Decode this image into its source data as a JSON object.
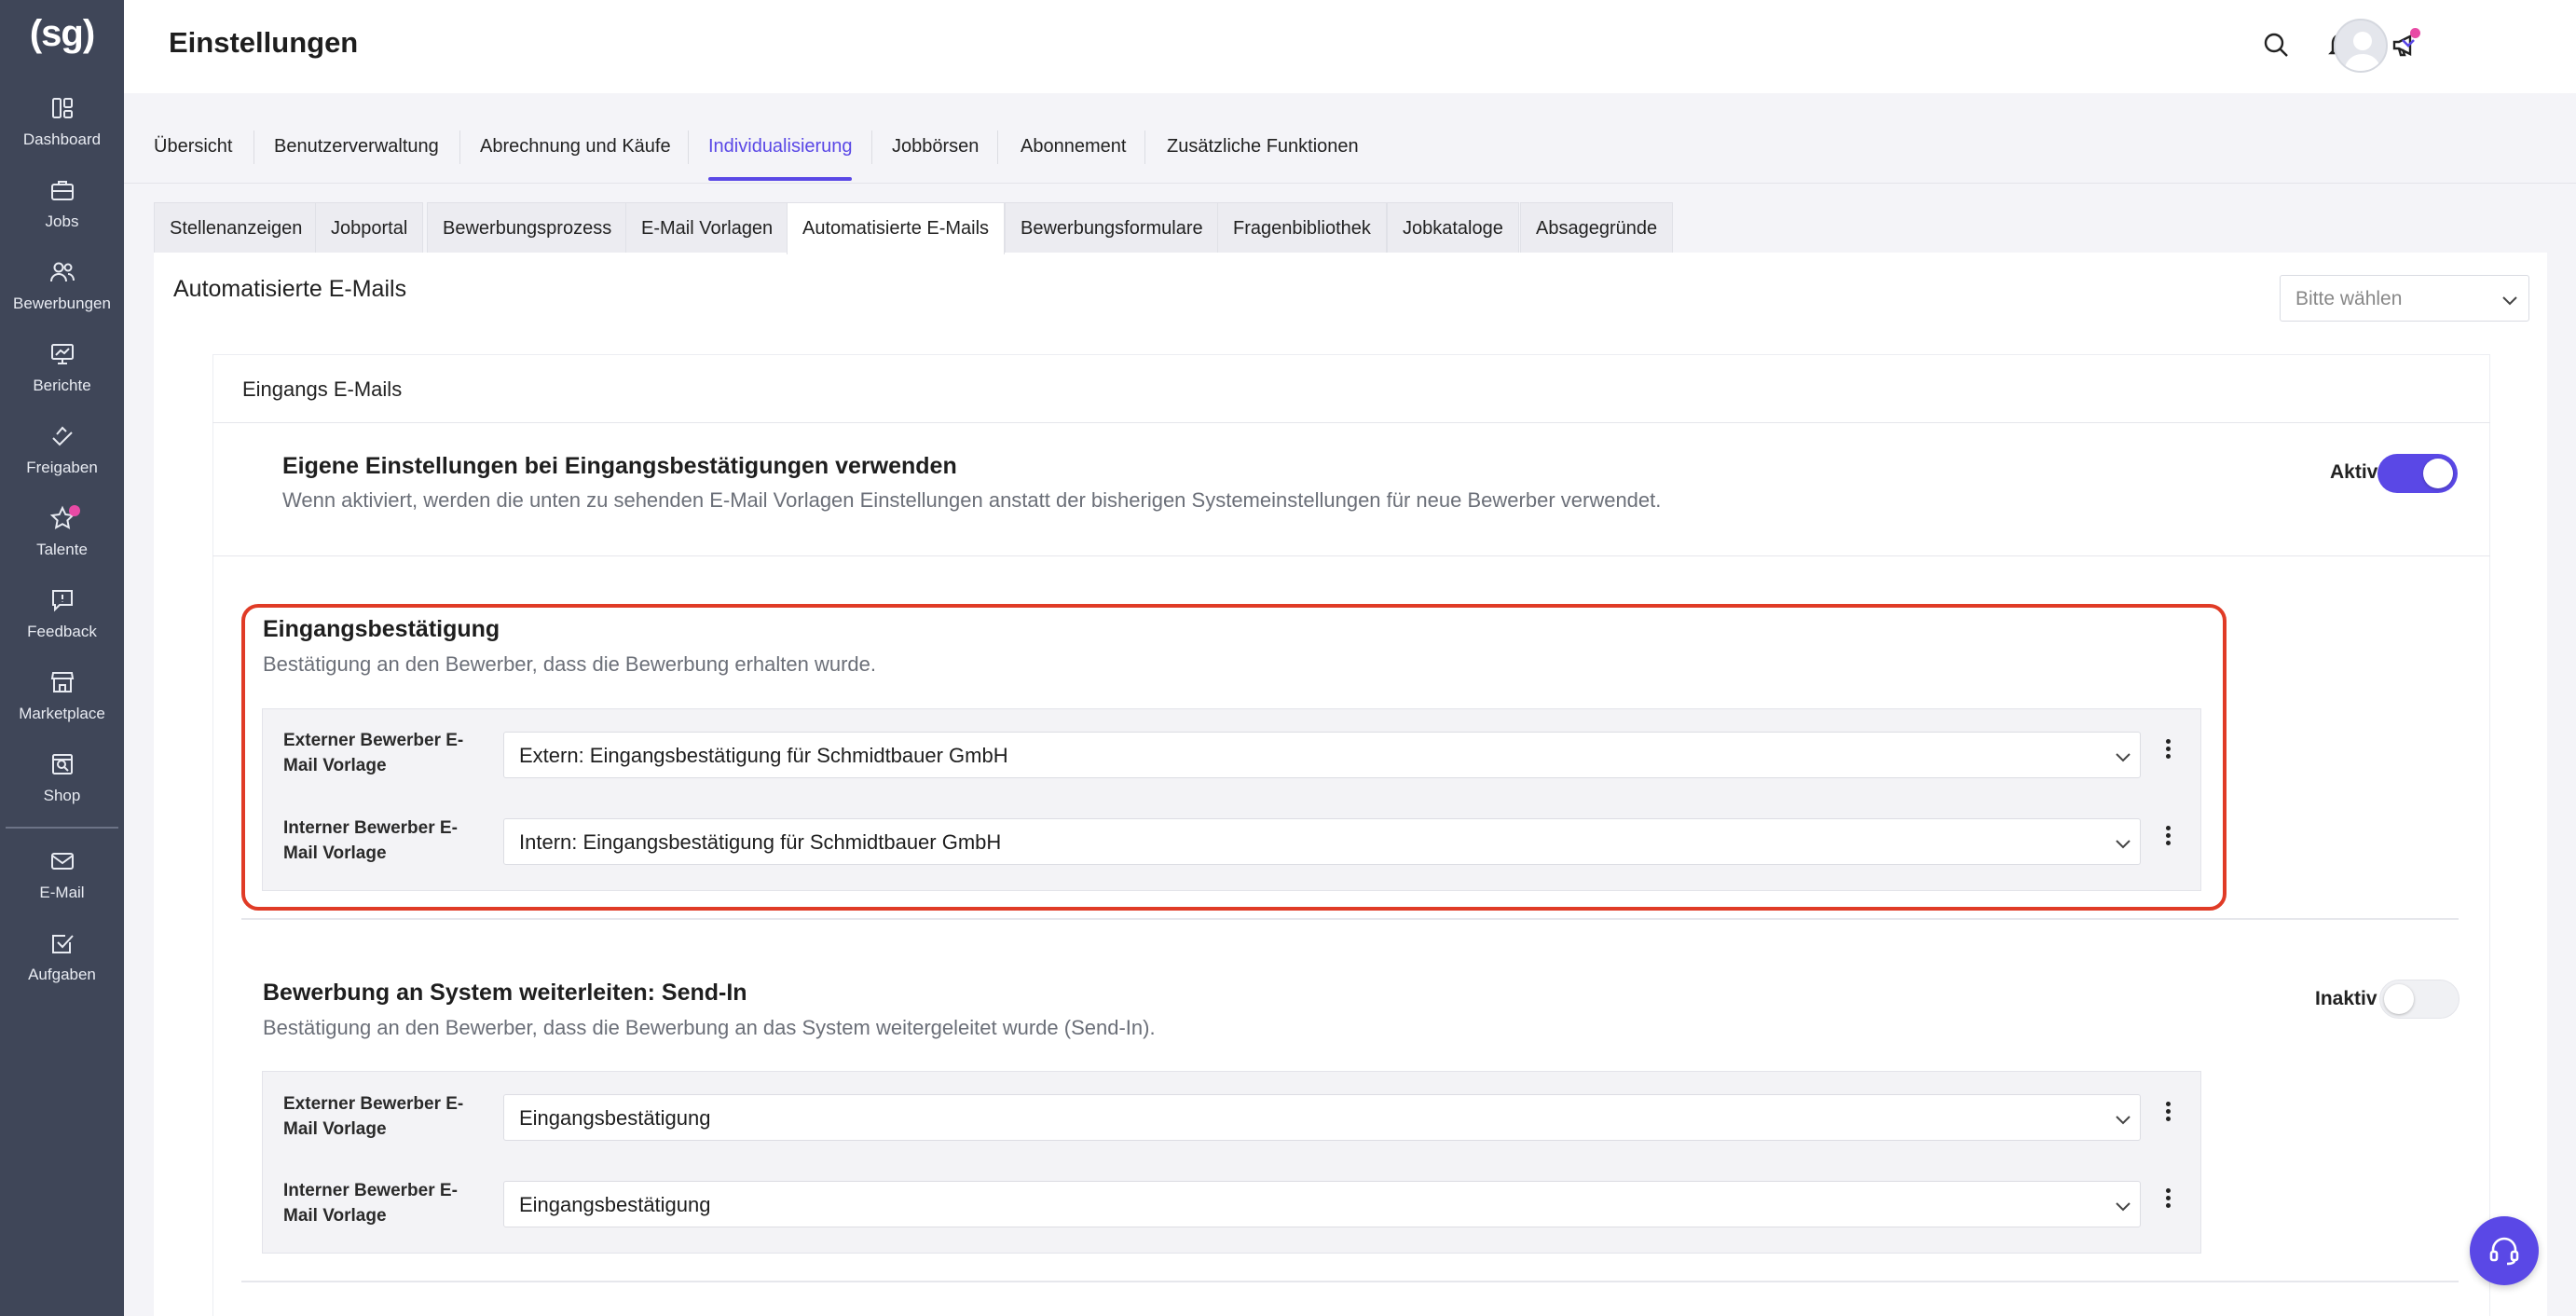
{
  "app": {
    "logo": "(sg)"
  },
  "sidebar": {
    "items": [
      {
        "label": "Dashboard",
        "icon": "dashboard-icon"
      },
      {
        "label": "Jobs",
        "icon": "briefcase-icon"
      },
      {
        "label": "Bewerbungen",
        "icon": "users-icon"
      },
      {
        "label": "Berichte",
        "icon": "chart-board-icon"
      },
      {
        "label": "Freigaben",
        "icon": "hand-approve-icon"
      },
      {
        "label": "Talente",
        "icon": "star-icon",
        "badge": true
      },
      {
        "label": "Feedback",
        "icon": "feedback-icon"
      },
      {
        "label": "Marketplace",
        "icon": "store-icon"
      },
      {
        "label": "Shop",
        "icon": "shop-search-icon"
      },
      {
        "label": "E-Mail",
        "icon": "mail-icon"
      },
      {
        "label": "Aufgaben",
        "icon": "checkbox-icon"
      }
    ]
  },
  "header": {
    "title": "Einstellungen",
    "icons": [
      "search-icon",
      "bell-icon",
      "megaphone-icon"
    ],
    "accent_color": "#5a48e6",
    "badge_color": "#e84aa5"
  },
  "tabs": [
    "Übersicht",
    "Benutzerverwaltung",
    "Abrechnung und Käufe",
    "Individualisierung",
    "Jobbörsen",
    "Abonnement",
    "Zusätzliche Funktionen"
  ],
  "active_tab": "Individualisierung",
  "subtabs": [
    "Stellenanzeigen",
    "Jobportal",
    "Bewerbungsprozess",
    "E-Mail Vorlagen",
    "Automatisierte E-Mails",
    "Bewerbungsformulare",
    "Fragenbibliothek",
    "Jobkataloge",
    "Absagegründe"
  ],
  "active_subtab": "Automatisierte E-Mails",
  "content": {
    "title": "Automatisierte E-Mails",
    "filter_placeholder": "Bitte wählen",
    "group_title": "Eingangs E-Mails",
    "own_settings": {
      "title": "Eigene Einstellungen bei Eingangsbestätigungen verwenden",
      "description": "Wenn aktiviert, werden die unten zu sehenden E-Mail Vorlagen Einstellungen anstatt der bisherigen Systemeinstellungen für neue Bewerber verwendet.",
      "toggle_label": "Aktiv",
      "toggle_on": true
    },
    "sections": [
      {
        "title": "Eingangsbestätigung",
        "description": "Bestätigung an den Bewerber, dass die Bewerbung erhalten wurde.",
        "highlight_color": "#e03b26",
        "rows": [
          {
            "label": "Externer Bewerber E-Mail Vorlage",
            "value": "Extern: Eingangsbestätigung für Schmidtbauer GmbH"
          },
          {
            "label": "Interner Bewerber E-Mail Vorlage",
            "value": "Intern: Eingangsbestätigung für Schmidtbauer GmbH"
          }
        ]
      },
      {
        "title": "Bewerbung an System weiterleiten: Send-In",
        "description": "Bestätigung an den Bewerber, dass die Bewerbung an das System weitergeleitet wurde (Send-In).",
        "toggle_label": "Inaktiv",
        "toggle_on": false,
        "rows": [
          {
            "label": "Externer Bewerber E-Mail Vorlage",
            "value": "Eingangsbestätigung"
          },
          {
            "label": "Interner Bewerber E-Mail Vorlage",
            "value": "Eingangsbestätigung"
          }
        ]
      }
    ]
  },
  "help": {
    "icon": "headset-icon"
  }
}
